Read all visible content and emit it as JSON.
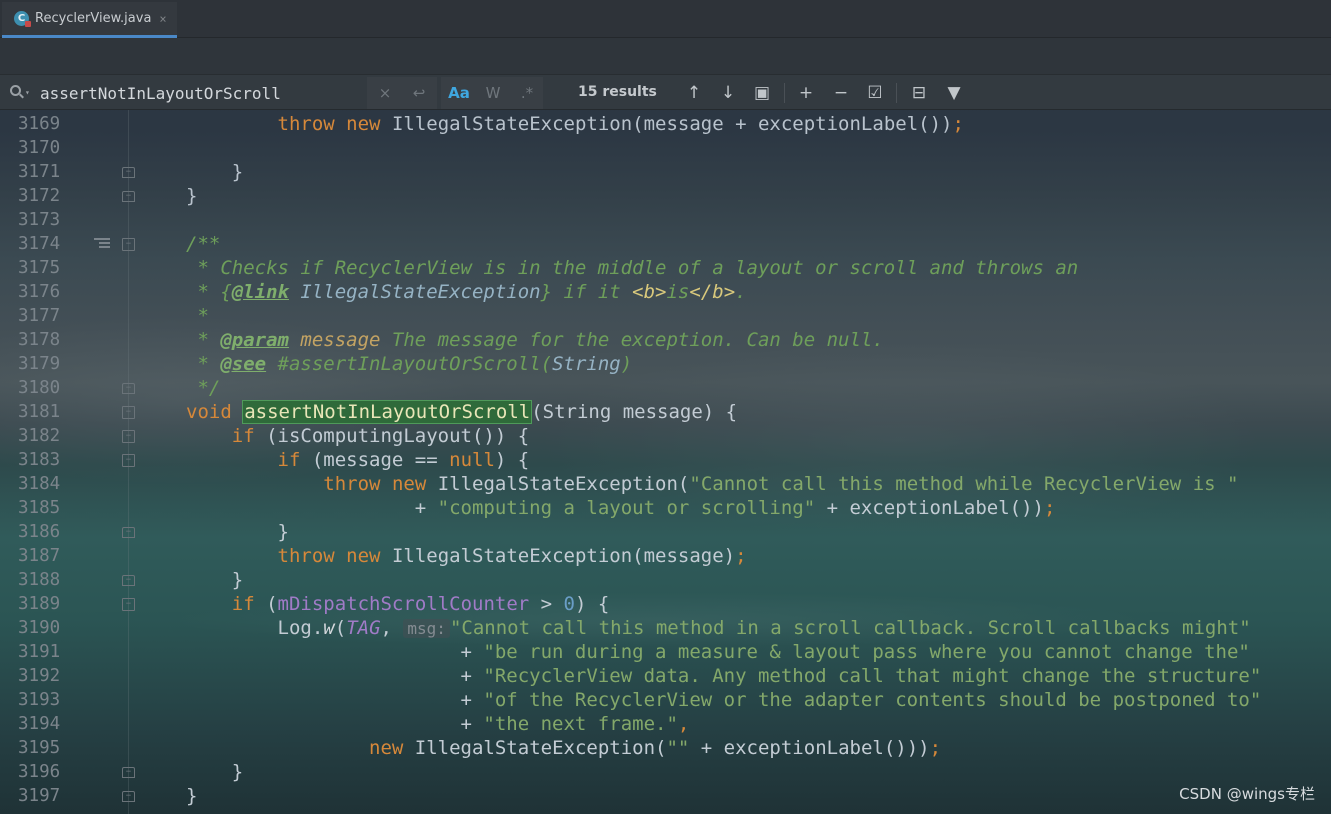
{
  "tab": {
    "icon": "java-class-icon",
    "icon_letter": "C",
    "label": "RecyclerView.java",
    "close": "×"
  },
  "find": {
    "query": "assertNotInLayoutOrScroll",
    "clear": "×",
    "newline": "↩",
    "match_case": "Aa",
    "words": "W",
    "regex": ".*",
    "results": "15 results",
    "tools": {
      "prev": "↑",
      "next": "↓",
      "select_all": "▣",
      "add_occurrence": "+",
      "remove_occurrence": "−",
      "select_all_occurrences": "☑",
      "filter_options": "⊟",
      "filter": "▼"
    }
  },
  "editor": {
    "line_numbers": [
      "3169",
      "3170",
      "3171",
      "3172",
      "3173",
      "3174",
      "3175",
      "3176",
      "3177",
      "3178",
      "3179",
      "3180",
      "3181",
      "3182",
      "3183",
      "3184",
      "3185",
      "3186",
      "3187",
      "3188",
      "3189",
      "3190",
      "3191",
      "3192",
      "3193",
      "3194",
      "3195",
      "3196",
      "3197"
    ],
    "code": {
      "l3169_a": "        ",
      "l3169_kw1": "throw",
      "l3169_b": " ",
      "l3169_kw2": "new",
      "l3169_c": " IllegalStateException(message + exceptionLabel())",
      "l3169_semi": ";",
      "l3171": "    }",
      "l3172": "}",
      "l3174": "/**",
      "l3175": " * Checks if RecyclerView is in the middle of a layout or scroll and throws an",
      "l3176_a": " * {",
      "l3176_tag": "@link",
      "l3176_ref": " IllegalStateException",
      "l3176_b": "} if it ",
      "l3176_h1": "<b>",
      "l3176_c": "is",
      "l3176_h2": "</b>",
      "l3176_d": ".",
      "l3177": " *",
      "l3178_a": " * ",
      "l3178_tag": "@param",
      "l3178_name": " message",
      "l3178_b": " The message for the exception. Can be null.",
      "l3179_a": " * ",
      "l3179_tag": "@see",
      "l3179_b": " #assertInLayoutOrScroll(",
      "l3179_ref": "String",
      "l3179_c": ")",
      "l3180": " */",
      "l3181_kw": "void",
      "l3181_sp": " ",
      "l3181_name": "assertNotInLayoutOrScroll",
      "l3181_rest": "(String message) {",
      "l3182_a": "    ",
      "l3182_kw": "if",
      "l3182_b": " (isComputingLayout()) {",
      "l3183_a": "        ",
      "l3183_kw": "if",
      "l3183_b": " (message == ",
      "l3183_kw2": "null",
      "l3183_c": ") {",
      "l3184_a": "            ",
      "l3184_kw1": "throw",
      "l3184_b": " ",
      "l3184_kw2": "new",
      "l3184_c": " IllegalStateException(",
      "l3184_str": "\"Cannot call this method while RecyclerView is \"",
      "l3185_a": "                    + ",
      "l3185_str": "\"computing a layout or scrolling\"",
      "l3185_b": " + exceptionLabel())",
      "l3185_semi": ";",
      "l3186": "        }",
      "l3187_a": "        ",
      "l3187_kw1": "throw",
      "l3187_b": " ",
      "l3187_kw2": "new",
      "l3187_c": " IllegalStateException(message)",
      "l3187_semi": ";",
      "l3188": "    }",
      "l3189_a": "    ",
      "l3189_kw": "if",
      "l3189_b": " (",
      "l3189_fld": "mDispatchScrollCounter",
      "l3189_c": " > ",
      "l3189_num": "0",
      "l3189_d": ") {",
      "l3190_a": "        Log.",
      "l3190_mth": "w",
      "l3190_b": "(",
      "l3190_const": "TAG",
      "l3190_c": ", ",
      "l3190_hint": "msg:",
      "l3190_str": "\"Cannot call this method in a scroll callback. Scroll callbacks might\"",
      "l3191_a": "                        + ",
      "l3191_str": "\"be run during a measure & layout pass where you cannot change the\"",
      "l3192_a": "                        + ",
      "l3192_str": "\"RecyclerView data. Any method call that might change the structure\"",
      "l3193_a": "                        + ",
      "l3193_str": "\"of the RecyclerView or the adapter contents should be postponed to\"",
      "l3194_a": "                        + ",
      "l3194_str": "\"the next frame.\"",
      "l3194_b": ",",
      "l3195_a": "                ",
      "l3195_kw": "new",
      "l3195_b": " IllegalStateException(",
      "l3195_str": "\"\"",
      "l3195_c": " + exceptionLabel()))",
      "l3195_semi": ";",
      "l3196": "    }",
      "l3197": "}"
    }
  },
  "watermark": "CSDN @wings专栏",
  "colors": {
    "accent": "#4a88c7",
    "keyword": "#d6883a",
    "string": "#84a86a",
    "comment": "#6e9f5a",
    "match_highlight": "#2f6a3a"
  }
}
